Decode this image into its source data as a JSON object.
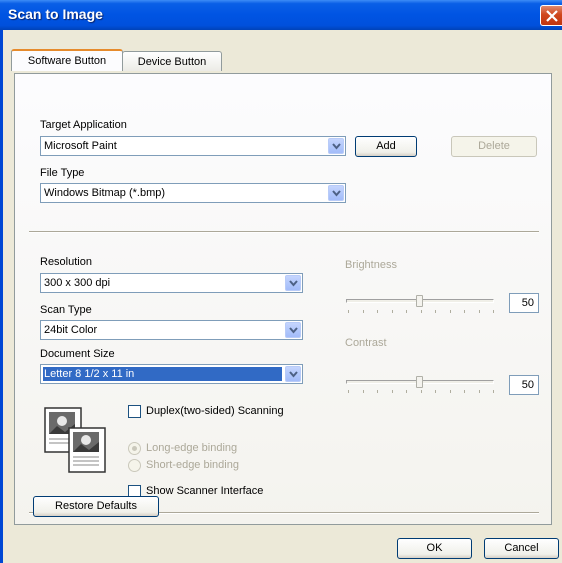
{
  "window": {
    "title": "Scan to Image",
    "close_icon": "close-icon"
  },
  "tabs": [
    {
      "label": "Software Button",
      "active": true
    },
    {
      "label": "Device Button",
      "active": false
    }
  ],
  "target_application": {
    "label": "Target Application",
    "value": "Microsoft Paint",
    "add_label": "Add",
    "delete_label": "Delete"
  },
  "file_type": {
    "label": "File Type",
    "value": "Windows Bitmap (*.bmp)"
  },
  "resolution": {
    "label": "Resolution",
    "value": "300 x 300 dpi"
  },
  "scan_type": {
    "label": "Scan Type",
    "value": "24bit Color"
  },
  "document_size": {
    "label": "Document Size",
    "value": "Letter 8 1/2 x 11 in"
  },
  "brightness": {
    "label": "Brightness",
    "value": "50",
    "level_percent": 50
  },
  "contrast": {
    "label": "Contrast",
    "value": "50",
    "level_percent": 50
  },
  "duplex": {
    "label": "Duplex(two-sided) Scanning",
    "checked": false,
    "long_edge_label": "Long-edge binding",
    "short_edge_label": "Short-edge binding",
    "long_edge_selected": true,
    "icon": "duplex-pages-icon"
  },
  "scanner_interface": {
    "label": "Show Scanner Interface",
    "checked": false
  },
  "buttons": {
    "restore_defaults": "Restore Defaults",
    "ok": "OK",
    "cancel": "Cancel"
  },
  "colors": {
    "titlebar": "#0054e3",
    "dialog_bg": "#ece9d8",
    "selection": "#316ac5",
    "active_tab_accent": "#e68b2c"
  }
}
